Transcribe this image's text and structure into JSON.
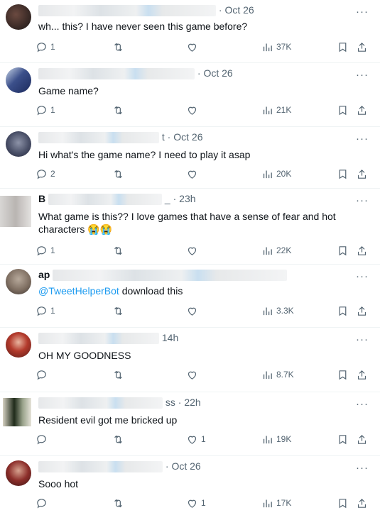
{
  "replies": [
    {
      "name_visible": "",
      "handle_tail": "",
      "time": "Oct 26",
      "text_prefix": "",
      "text": "wh...  this? I have never seen this game before?",
      "replies": "1",
      "reposts": "",
      "likes": "",
      "views": "37K"
    },
    {
      "name_visible": "",
      "handle_tail": "",
      "time": "Oct 26",
      "text_prefix": "",
      "text": "Game name?",
      "replies": "1",
      "reposts": "",
      "likes": "",
      "views": "21K"
    },
    {
      "name_visible": "",
      "handle_tail": "t",
      "time": "Oct 26",
      "text_prefix": "",
      "text": "Hi what's the game name? I need to play it asap",
      "replies": "2",
      "reposts": "",
      "likes": "",
      "views": "20K"
    },
    {
      "name_visible": "B",
      "handle_tail": "_",
      "time": "23h",
      "text_prefix": "",
      "text": "What game is this?? I love games that have a sense of fear and hot characters 😭😭",
      "replies": "1",
      "reposts": "",
      "likes": "",
      "views": "22K"
    },
    {
      "name_visible": "ap",
      "handle_tail": "",
      "time": "",
      "text_prefix": "@TweetHelperBot",
      "text": " download this",
      "replies": "1",
      "reposts": "",
      "likes": "",
      "views": "3.3K"
    },
    {
      "name_visible": "",
      "handle_tail": "",
      "time": "14h",
      "text_prefix": "",
      "text": "OH MY GOODNESS",
      "replies": "",
      "reposts": "",
      "likes": "",
      "views": "8.7K"
    },
    {
      "name_visible": "",
      "handle_tail": "ss",
      "time": "22h",
      "text_prefix": "",
      "text": "Resident evil got me bricked up",
      "replies": "",
      "reposts": "",
      "likes": "1",
      "views": "19K"
    },
    {
      "name_visible": "",
      "handle_tail": "",
      "time": "Oct 26",
      "text_prefix": "",
      "text": "Sooo hot",
      "replies": "",
      "reposts": "",
      "likes": "1",
      "views": "17K"
    }
  ],
  "more_label": "···",
  "separator": "·"
}
